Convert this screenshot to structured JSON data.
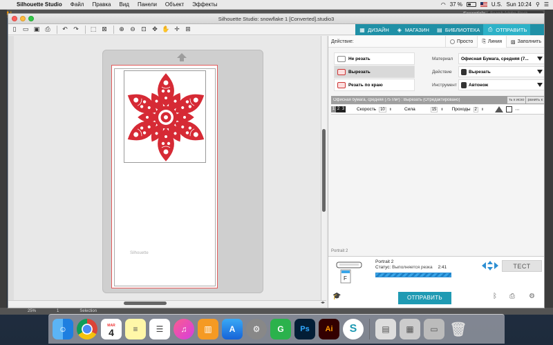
{
  "menubar": {
    "app_name": "Silhouette Studio",
    "items": [
      "Файл",
      "Правка",
      "Вид",
      "Панели",
      "Объект",
      "Эффекты"
    ],
    "language": "U.S.",
    "battery": "37 %",
    "clock": "Sun 10:24"
  },
  "background_app": {
    "logo": "Ai",
    "workspace": "Essentials",
    "search_placeholder": "Search Adobe Stock",
    "zoom": "25%",
    "page": "1",
    "tool": "Selection"
  },
  "window": {
    "title": "Silhouette Studio: snowflake 1 [Converted].studio3"
  },
  "topnav": {
    "items": [
      {
        "label": "ДИЗАЙН",
        "icon": "design-icon"
      },
      {
        "label": "МАГАЗИН",
        "icon": "store-icon"
      },
      {
        "label": "БИБЛИОТЕКА",
        "icon": "library-icon"
      },
      {
        "label": "ОТПРАВИТЬ",
        "icon": "send-icon"
      }
    ]
  },
  "canvas": {
    "mat_brand": "Silhouette"
  },
  "panel": {
    "action_label": "Действие:",
    "mode_tabs": [
      "Просто",
      "Линия",
      "Заполнить"
    ],
    "actions": [
      "Не резать",
      "Вырезать",
      "Резать по краю"
    ],
    "settings": {
      "material_label": "Материал",
      "material_value": "Офисная Бумага, средняя (7...",
      "action_label": "Действие",
      "action_value": "Вырезать",
      "tool_label": "Инструмент",
      "tool_value": "Автонож"
    },
    "info_text": "Офисная бумага, средняя (75 г/м²) : Вырезать (Отредактировано)",
    "info_btn1": "ть к исхо",
    "info_btn2": "ранить к",
    "params": {
      "blade": [
        "1",
        "2",
        "3"
      ],
      "speed_label": "Скорость",
      "speed_value": "10",
      "force_label": "Сила",
      "force_value": "15",
      "passes_label": "Проходы",
      "passes_value": "2"
    },
    "device_label": "Portrait 2",
    "send": {
      "device_name": "Portrait 2",
      "status_label": "Статус:",
      "status_value": "Выполняется резка",
      "time": "2:41",
      "progress": 0.99,
      "test_label": "ТЕСТ",
      "send_label": "ОТПРАВИТЬ",
      "machine_letter": "F"
    }
  },
  "colors": {
    "accent": "#1f90a6",
    "design_red": "#d62a35",
    "progress_blue": "#2d8fd3"
  }
}
